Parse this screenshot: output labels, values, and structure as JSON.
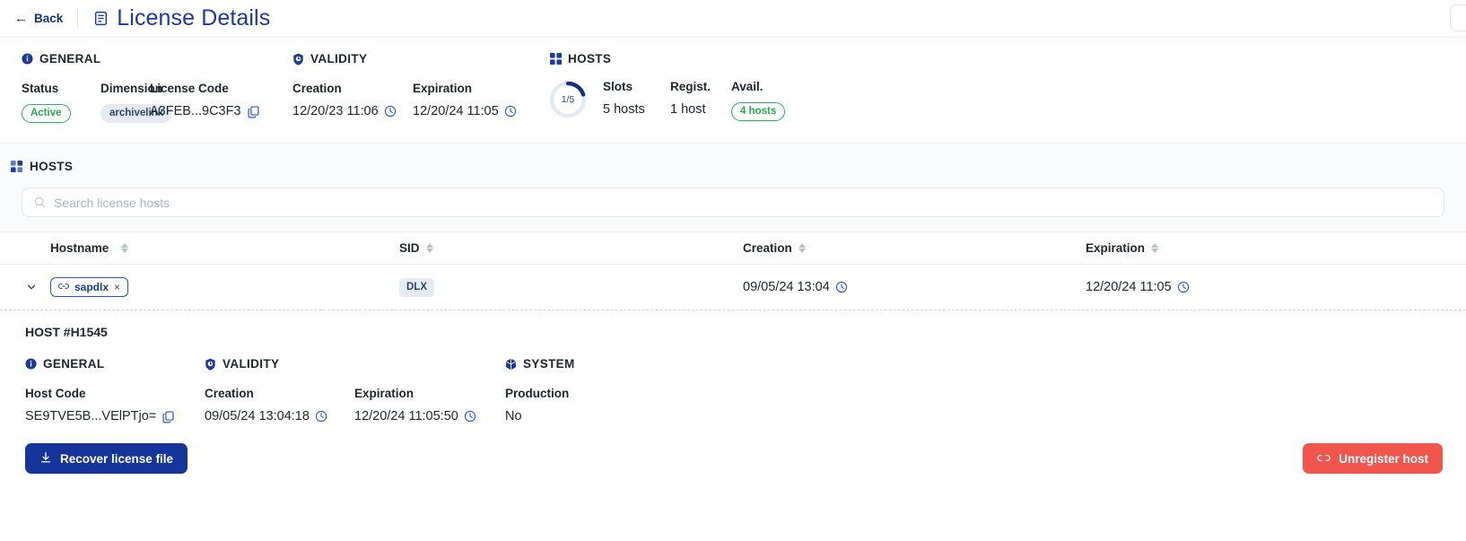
{
  "topbar": {
    "back_label": "Back",
    "back_icon": "arrow-left-icon",
    "doc_icon": "document-icon",
    "title": "License Details"
  },
  "summary": {
    "general": {
      "heading": "GENERAL",
      "icon": "info-circle-icon",
      "status_label": "Status",
      "status_value": "Active",
      "dimension_label": "Dimension",
      "dimension_value": "archivelink",
      "license_code_label": "License Code",
      "license_code_value": "A3FEB...9C3F3",
      "copy_icon": "copy-icon"
    },
    "validity": {
      "heading": "VALIDITY",
      "icon": "shield-clock-icon",
      "creation_label": "Creation",
      "creation_value": "12/20/23 11:06",
      "expiration_label": "Expiration",
      "expiration_value": "12/20/24 11:05",
      "clock_icon": "clock-icon"
    },
    "hosts": {
      "heading": "HOSTS",
      "icon": "grid-icon",
      "donut_label": "1/5",
      "donut_used": 1,
      "donut_total": 5,
      "slots_label": "Slots",
      "slots_value": "5 hosts",
      "registered_label": "Regist.",
      "registered_value": "1 host",
      "available_label": "Avail.",
      "available_value": "4 hosts"
    }
  },
  "hosts_section": {
    "heading": "HOSTS",
    "icon": "grid-icon",
    "search_placeholder": "Search license hosts",
    "search_value": "",
    "search_icon": "search-icon",
    "columns": [
      "Hostname",
      "SID",
      "Creation",
      "Expiration"
    ],
    "rows": [
      {
        "hostname": "sapdlx",
        "hostname_icon": "link-icon",
        "remove_icon": "×",
        "sid": "DLX",
        "creation": "09/05/24 13:04",
        "expiration": "12/20/24 11:05",
        "expanded": true
      }
    ]
  },
  "host_detail": {
    "title": "HOST #H1545",
    "general": {
      "heading": "GENERAL",
      "icon": "info-circle-icon",
      "host_code_label": "Host Code",
      "host_code_value": "SE9TVE5B...VElPTjo=",
      "copy_icon": "copy-icon"
    },
    "validity": {
      "heading": "VALIDITY",
      "icon": "shield-clock-icon",
      "creation_label": "Creation",
      "creation_value": "09/05/24 13:04:18",
      "expiration_label": "Expiration",
      "expiration_value": "12/20/24 11:05:50"
    },
    "system": {
      "heading": "SYSTEM",
      "icon": "cube-icon",
      "production_label": "Production",
      "production_value": "No"
    },
    "recover_button": "Recover license file",
    "recover_icon": "download-icon",
    "unregister_button": "Unregister host",
    "unregister_icon": "unlink-icon"
  },
  "colors": {
    "brand_blue": "#1b3a9c",
    "accent_blue": "#2a57c7",
    "success_green": "#2cb35a",
    "danger_red": "#f0554e",
    "badge_grey": "#e6eaf2"
  }
}
